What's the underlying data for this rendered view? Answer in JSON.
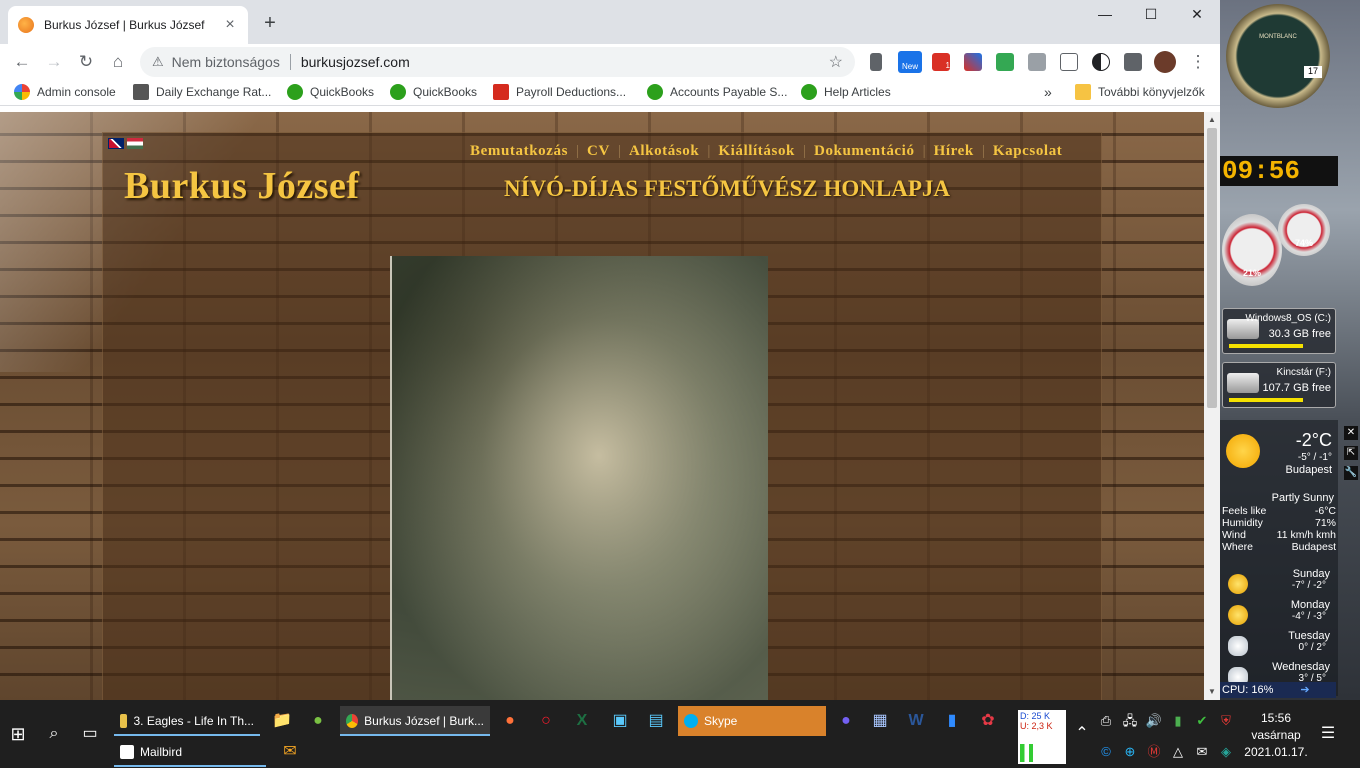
{
  "browser": {
    "tab_title": "Burkus József | Burkus József",
    "tab_close": "×",
    "new_tab": "+",
    "window_controls": [
      "—",
      "☐",
      "✕"
    ],
    "omnibox_security": "Nem biztonságos",
    "omnibox_url": "burkusjozsef.com",
    "ext_new_badge": "New",
    "ext_count_badge": "1",
    "bookmarks": [
      {
        "label": "Admin console",
        "color": "#4285f4"
      },
      {
        "label": "Daily Exchange Rat...",
        "color": "#555555"
      },
      {
        "label": "QuickBooks",
        "color": "#2ca01c"
      },
      {
        "label": "QuickBooks",
        "color": "#2ca01c"
      },
      {
        "label": "Payroll Deductions...",
        "color": "#d52b1e"
      },
      {
        "label": "Accounts Payable S...",
        "color": "#2ca01c"
      },
      {
        "label": "Help Articles",
        "color": "#2ca01c"
      }
    ],
    "bookmarks_overflow": "»",
    "other_bookmarks": "További könyvjelzők"
  },
  "site": {
    "title": "Burkus József",
    "subtitle": "NÍVÓ-DÍJAS FESTŐMŰVÉSZ HONLAPJA",
    "nav": [
      "Bemutatkozás",
      "CV",
      "Alkotások",
      "Kiállítások",
      "Dokumentáció",
      "Hírek",
      "Kapcsolat"
    ],
    "nav_divider": "|"
  },
  "gadgets": {
    "clock_brand": "MONTBLANC",
    "clock_date": "17",
    "digital_time": "09:56",
    "gauge_cpu": "21%",
    "gauge_mem": "74%",
    "drives": [
      {
        "name": "Windows8_OS (C:)",
        "free": "30.3 GB free"
      },
      {
        "name": "Kincstár (F:)",
        "free": "107.7 GB free"
      }
    ],
    "weather": {
      "temp": "-2°C",
      "range": "-5° / -1°",
      "city": "Budapest",
      "condition": "Partly Sunny",
      "details": [
        {
          "k": "Feels like",
          "v": "-6°C"
        },
        {
          "k": "Humidity",
          "v": "71%"
        },
        {
          "k": "Wind",
          "v": "11 km/h kmh"
        },
        {
          "k": "Where",
          "v": "Budapest"
        }
      ],
      "forecast": [
        {
          "day": "Sunday",
          "range": "-7° / -2°",
          "icon": "sun-icon"
        },
        {
          "day": "Monday",
          "range": "-4° / -3°",
          "icon": "sun-icon"
        },
        {
          "day": "Tuesday",
          "range": "0° / 2°",
          "icon": "cloud-icon"
        },
        {
          "day": "Wednesday",
          "range": "3° / 5°",
          "icon": "cloud-icon"
        }
      ]
    },
    "cpu": "CPU: 16%",
    "cpu_arrow": "➔",
    "buttons": [
      "✕",
      "⇱",
      "🔧"
    ]
  },
  "taskbar": {
    "apps": [
      {
        "label": "3. Eagles - Life In Th...",
        "color": "#e8c14a"
      },
      {
        "label": "Burkus József | Burk...",
        "color": "#4285f4"
      },
      {
        "label": "Skype",
        "color": "#00aff0"
      },
      {
        "label": "Mailbird",
        "color": "#ffffff"
      }
    ],
    "net_dl": "D: 25 K",
    "net_ul": "U: 2,3 K",
    "time": "15:56",
    "day": "vasárnap",
    "date": "2021.01.17.",
    "chevron": "⌃",
    "notifications_icon": "☰"
  }
}
